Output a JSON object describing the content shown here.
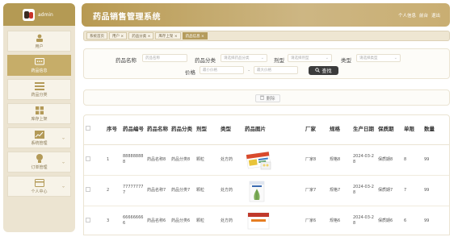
{
  "sidebar": {
    "username": "admin",
    "items": [
      {
        "label": "用户",
        "icon": "user-icon",
        "active": false,
        "has_arrow": false
      },
      {
        "label": "药品信息",
        "icon": "chat-dots-icon",
        "active": true,
        "has_arrow": false
      },
      {
        "label": "药品分类",
        "icon": "list-icon",
        "active": false,
        "has_arrow": false
      },
      {
        "label": "库存上架",
        "icon": "grid-icon",
        "active": false,
        "has_arrow": false
      },
      {
        "label": "系统管理",
        "icon": "chart-icon",
        "active": false,
        "has_arrow": true
      },
      {
        "label": "订单管理",
        "icon": "pin-icon",
        "active": false,
        "has_arrow": true
      },
      {
        "label": "个人中心",
        "icon": "card-icon",
        "active": false,
        "has_arrow": true
      }
    ]
  },
  "header": {
    "title": "药品销售管理系统",
    "links": [
      "个人信息",
      "前台",
      "退出"
    ]
  },
  "tabs": [
    {
      "label": "系统首页",
      "active": false
    },
    {
      "label": "用户 ×",
      "active": false
    },
    {
      "label": "药品分类 ×",
      "active": false
    },
    {
      "label": "库存上架 ×",
      "active": false
    },
    {
      "label": "药品信息 ×",
      "active": true
    }
  ],
  "search": {
    "name_label": "药品名称",
    "name_placeholder": "药品名称",
    "category_label": "药品分类",
    "category_placeholder": "请选择药品分类",
    "form_label": "剂型",
    "form_placeholder": "请选择剂型",
    "type_label": "类型",
    "type_placeholder": "请选择类型",
    "price_label": "价格",
    "price_min_placeholder": "最小价格",
    "price_max_placeholder": "最大价格",
    "search_button": "查找",
    "dash": "-"
  },
  "actions": {
    "delete_button": "删除"
  },
  "table": {
    "columns": [
      "",
      "序号",
      "药品编号",
      "药品名称",
      "药品分类",
      "剂型",
      "类型",
      "药品图片",
      "厂家",
      "规格",
      "生产日期",
      "保质期",
      "单限",
      "数量"
    ],
    "rows": [
      {
        "index": "1",
        "code": "888888888",
        "name": "药品名称8",
        "category": "药品分类8",
        "form": "颗粒",
        "type": "处方药",
        "maker": "厂家8",
        "spec": "规格8",
        "date": "2024-03-28",
        "shelf": "保质期8",
        "limit": "8",
        "qty": "99",
        "image": "medicine-box-image-1"
      },
      {
        "index": "2",
        "code": "777777777",
        "name": "药品名称7",
        "category": "药品分类7",
        "form": "颗粒",
        "type": "处方药",
        "maker": "厂家7",
        "spec": "规格7",
        "date": "2024-03-28",
        "shelf": "保质期7",
        "limit": "7",
        "qty": "99",
        "image": "medicine-box-image-2"
      },
      {
        "index": "3",
        "code": "666666666",
        "name": "药品名称6",
        "category": "药品分类6",
        "form": "颗粒",
        "type": "处方药",
        "maker": "厂家6",
        "spec": "规格6",
        "date": "2024-03-28",
        "shelf": "保质期6",
        "limit": "6",
        "qty": "99",
        "image": "medicine-box-image-3"
      }
    ]
  }
}
